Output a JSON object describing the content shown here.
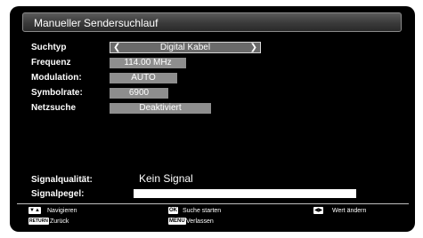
{
  "title": "Manueller Sendersuchlauf",
  "fields": {
    "suchtyp": {
      "label": "Suchtyp",
      "value": "Digital Kabel"
    },
    "frequenz": {
      "label": "Frequenz",
      "value": "114.00 MHz"
    },
    "modulation": {
      "label": "Modulation:",
      "value": "AUTO"
    },
    "symbolrate": {
      "label": "Symbolrate:",
      "value": "6900"
    },
    "netzsuche": {
      "label": "Netzsuche",
      "value": "Deaktiviert"
    }
  },
  "signal": {
    "quality_label": "Signalqualität:",
    "quality_value": "Kein Signal",
    "level_label": "Signalpegel:"
  },
  "footer": {
    "navigate": "Navigieren",
    "back_key": "RETURN",
    "back": "Zurück",
    "ok_key": "OK",
    "start": "Suche starten",
    "menu_key": "MENU",
    "exit": "Verlassen",
    "change": "Wert ändern"
  },
  "icons": {
    "left": "chevron-left-icon",
    "right": "chevron-right-icon",
    "nav": "up-down-arrows-icon",
    "leftright": "left-right-arrows-icon"
  }
}
